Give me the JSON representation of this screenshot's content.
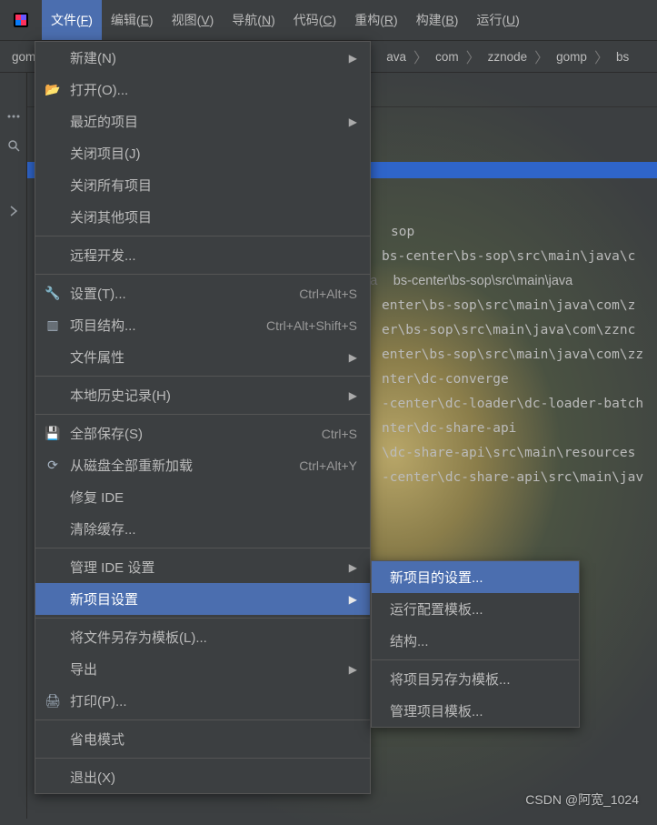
{
  "menubar": {
    "items": [
      {
        "label": "文件(F)",
        "underline": "F"
      },
      {
        "label": "编辑(E)",
        "underline": "E"
      },
      {
        "label": "视图(V)",
        "underline": "V"
      },
      {
        "label": "导航(N)",
        "underline": "N"
      },
      {
        "label": "代码(C)",
        "underline": "C"
      },
      {
        "label": "重构(R)",
        "underline": "R"
      },
      {
        "label": "构建(B)",
        "underline": "B"
      },
      {
        "label": "运行(U)",
        "underline": "U"
      }
    ]
  },
  "breadcrumbs": {
    "prefix": "gom",
    "items": [
      "ava",
      "com",
      "zznode",
      "gomp",
      "bs"
    ]
  },
  "filemenu": {
    "new": "新建(N)",
    "open": "打开(O)...",
    "recent": "最近的项目",
    "closeProject": "关闭项目(J)",
    "closeAllProjects": "关闭所有项目",
    "closeOtherProjects": "关闭其他项目",
    "remoteDev": "远程开发...",
    "settings": "设置(T)...",
    "settingsShortcut": "Ctrl+Alt+S",
    "projectStructure": "项目结构...",
    "projectStructureShortcut": "Ctrl+Alt+Shift+S",
    "fileProperties": "文件属性",
    "localHistory": "本地历史记录(H)",
    "saveAll": "全部保存(S)",
    "saveAllShortcut": "Ctrl+S",
    "reloadFromDisk": "从磁盘全部重新加载",
    "reloadShortcut": "Ctrl+Alt+Y",
    "repairIDE": "修复 IDE",
    "clearCache": "清除缓存...",
    "manageIDESettings": "管理 IDE 设置",
    "newProjectSettings": "新项目设置",
    "saveAsTemplate": "将文件另存为模板(L)...",
    "export": "导出",
    "print": "打印(P)...",
    "powerSave": "省电模式",
    "exit": "退出(X)"
  },
  "submenu": {
    "newProjectSettings": "新项目的设置...",
    "runConfigTemplates": "运行配置模板...",
    "structure": "结构...",
    "saveProjectAsTemplate": "将项目另存为模板...",
    "manageProjectTemplates": "管理项目模板..."
  },
  "editor": {
    "title": "sop",
    "paths": [
      "bs-center\\bs-sop\\src\\main\\java\\c",
      "bs-center\\bs-sop\\src\\main\\java",
      "enter\\bs-sop\\src\\main\\java\\com\\z",
      "er\\bs-sop\\src\\main\\java\\com\\zznc",
      "enter\\bs-sop\\src\\main\\java\\com\\zz",
      "nter\\dc-converge",
      "-center\\dc-loader\\dc-loader-batch",
      "nter\\dc-share-api",
      "\\dc-share-api\\src\\main\\resources",
      "-center\\dc-share-api\\src\\main\\jav"
    ],
    "javaKw": "va"
  },
  "watermark": "CSDN @阿宽_1024"
}
